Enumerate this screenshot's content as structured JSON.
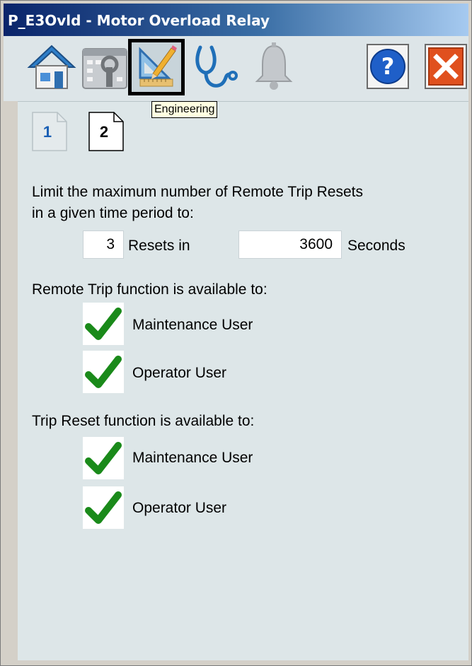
{
  "window": {
    "title": "P_E3Ovld - Motor Overload Relay"
  },
  "toolbar": {
    "tooltip": "Engineering",
    "buttons": [
      {
        "icon": "home-icon"
      },
      {
        "icon": "maintenance-icon"
      },
      {
        "icon": "engineering-icon",
        "active": true
      },
      {
        "icon": "diagnostics-icon"
      },
      {
        "icon": "alarm-bell-icon"
      },
      {
        "icon": "help-icon"
      },
      {
        "icon": "close-icon"
      }
    ]
  },
  "pages": {
    "page1": "1",
    "page2": "2"
  },
  "limit": {
    "text_line1": "Limit the maximum number of Remote Trip Resets",
    "text_line2": "in a given time period to:",
    "resets_value": "3",
    "resets_label": "Resets in",
    "seconds_value": "3600",
    "seconds_label": "Seconds"
  },
  "remote_trip": {
    "heading": "Remote Trip function is available to:",
    "maintenance_label": "Maintenance User",
    "maintenance_checked": true,
    "operator_label": "Operator User",
    "operator_checked": true
  },
  "trip_reset": {
    "heading": "Trip Reset function is available to:",
    "maintenance_label": "Maintenance User",
    "maintenance_checked": true,
    "operator_label": "Operator User",
    "operator_checked": true
  },
  "colors": {
    "check_green": "#1a8a1a",
    "link_blue": "#1a5fb4",
    "close_red": "#e0501e"
  }
}
